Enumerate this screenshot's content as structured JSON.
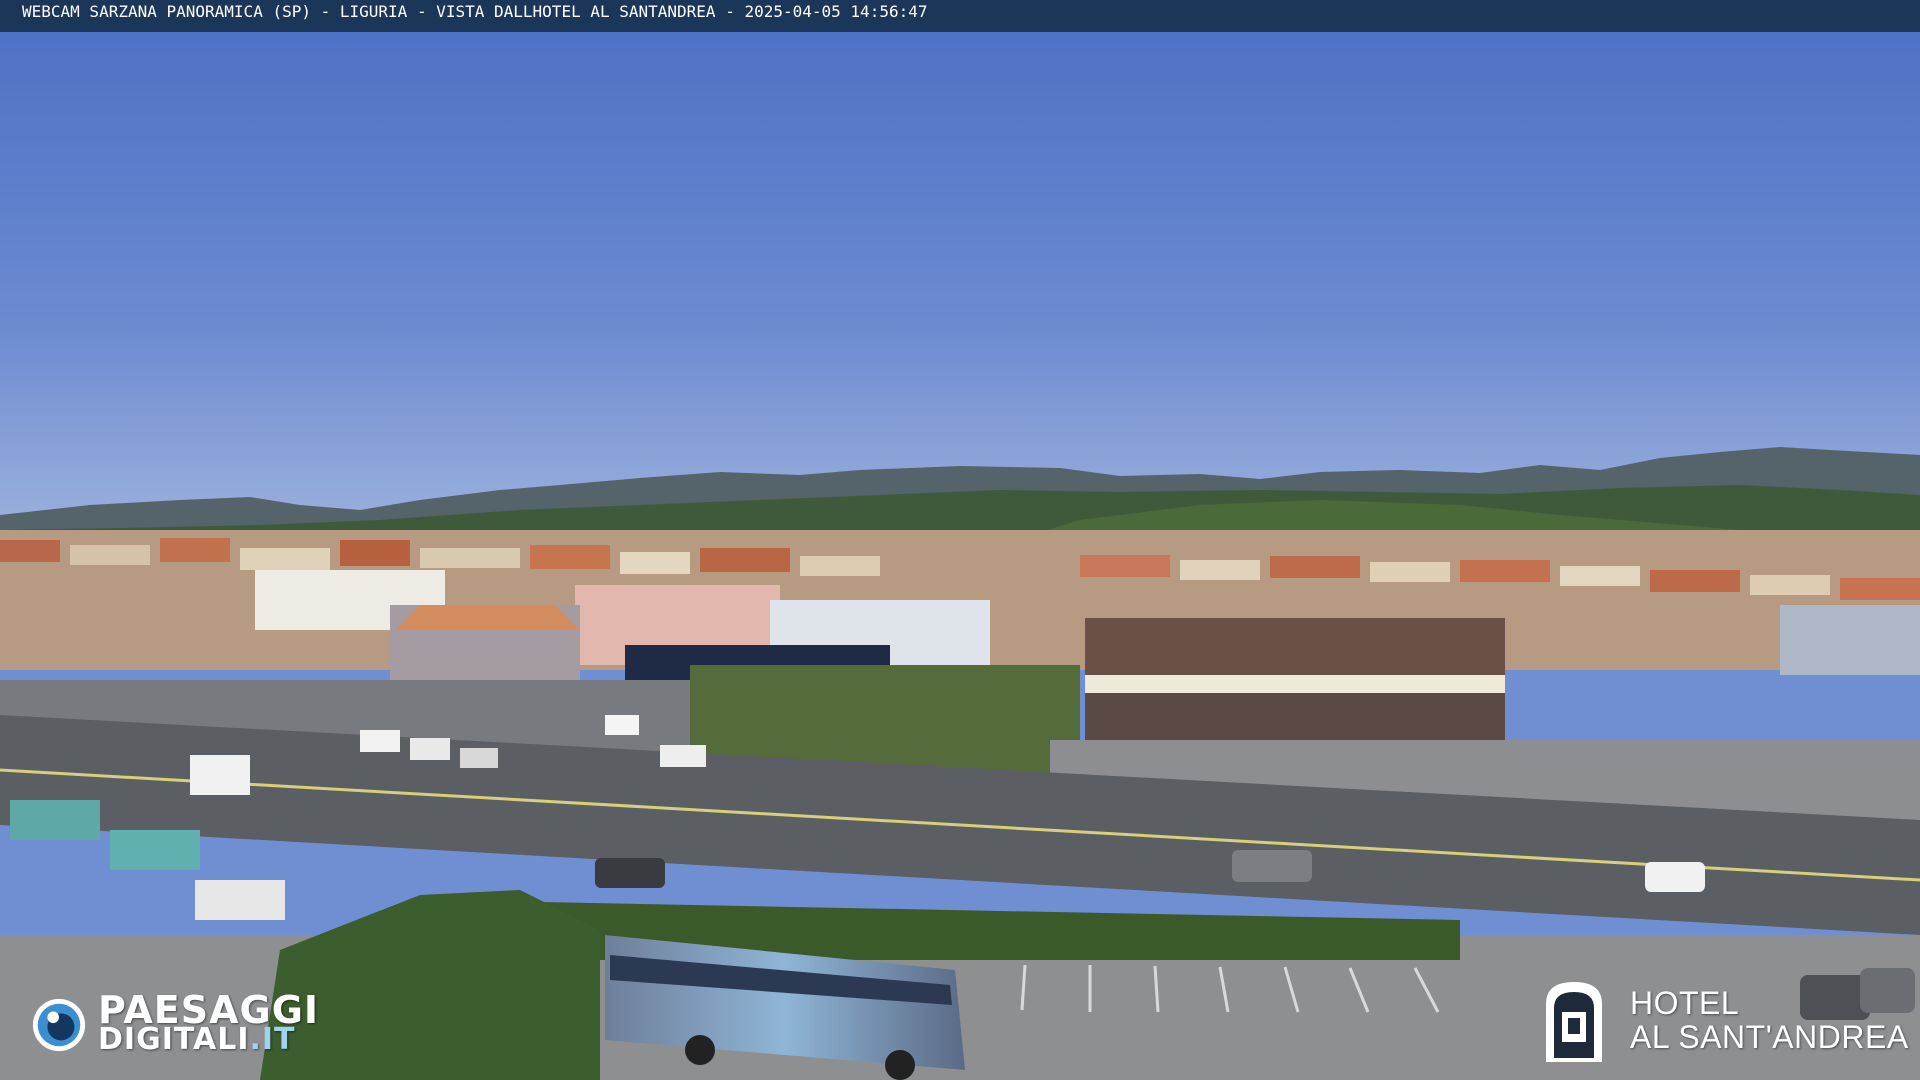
{
  "overlay": {
    "caption": "WEBCAM SARZANA PANORAMICA (SP) - LIGURIA - VISTA DALLHOTEL AL SANTANDREA - 2025-04-05   14:56:47"
  },
  "watermarks": {
    "left_logo_line1": "PAESAGGI",
    "left_logo_line2": "DIGITALI",
    "left_logo_tld": ".IT",
    "right_logo_line1": "HOTEL",
    "right_logo_line2": "AL SANT'ANDREA"
  },
  "colors": {
    "sky_top": "#4a6fc4",
    "sky_horizon": "#8fa8da",
    "caption_bar": "#1c3659"
  }
}
